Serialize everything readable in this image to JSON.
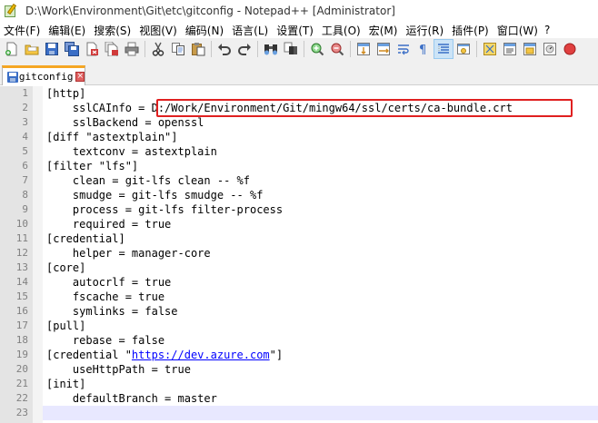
{
  "window": {
    "title": "D:\\Work\\Environment\\Git\\etc\\gitconfig - Notepad++ [Administrator]"
  },
  "menu": {
    "items": [
      "文件(F)",
      "编辑(E)",
      "搜索(S)",
      "视图(V)",
      "编码(N)",
      "语言(L)",
      "设置(T)",
      "工具(O)",
      "宏(M)",
      "运行(R)",
      "插件(P)",
      "窗口(W)",
      "?"
    ]
  },
  "toolbar": {
    "icons": [
      "new-file-icon",
      "open-file-icon",
      "save-icon",
      "save-all-icon",
      "close-icon",
      "close-all-icon",
      "print-icon",
      "cut-icon",
      "copy-icon",
      "paste-icon",
      "undo-icon",
      "redo-icon",
      "find-icon",
      "replace-icon",
      "zoom-in-icon",
      "zoom-out-icon",
      "sync-vertical-icon",
      "sync-horizontal-icon",
      "word-wrap-icon",
      "show-all-chars-icon",
      "indent-guide-icon",
      "user-lang-icon",
      "doc-map-icon",
      "function-list-icon",
      "folder-workspace-icon",
      "monitoring-icon",
      "record-macro-icon"
    ],
    "active_icon": "indent-guide-icon"
  },
  "tabs": [
    {
      "label": "gitconfig",
      "active": true,
      "close_symbol": "×"
    }
  ],
  "editor": {
    "lines": [
      {
        "num": "1",
        "text": "[http]"
      },
      {
        "num": "2",
        "text": "    sslCAInfo = D:/Work/Environment/Git/mingw64/ssl/certs/ca-bundle.crt"
      },
      {
        "num": "3",
        "text": "    sslBackend = openssl"
      },
      {
        "num": "4",
        "text": "[diff \"astextplain\"]"
      },
      {
        "num": "5",
        "text": "    textconv = astextplain"
      },
      {
        "num": "6",
        "text": "[filter \"lfs\"]"
      },
      {
        "num": "7",
        "text": "    clean = git-lfs clean -- %f"
      },
      {
        "num": "8",
        "text": "    smudge = git-lfs smudge -- %f"
      },
      {
        "num": "9",
        "text": "    process = git-lfs filter-process"
      },
      {
        "num": "10",
        "text": "    required = true"
      },
      {
        "num": "11",
        "text": "[credential]"
      },
      {
        "num": "12",
        "text": "    helper = manager-core"
      },
      {
        "num": "13",
        "text": "[core]"
      },
      {
        "num": "14",
        "text": "    autocrlf = true"
      },
      {
        "num": "15",
        "text": "    fscache = true"
      },
      {
        "num": "16",
        "text": "    symlinks = false"
      },
      {
        "num": "17",
        "text": "[pull]"
      },
      {
        "num": "18",
        "text": "    rebase = false"
      },
      {
        "num": "19",
        "text": "[credential \"",
        "url": "https://dev.azure.com",
        "after": "\"]"
      },
      {
        "num": "20",
        "text": "    useHttpPath = true"
      },
      {
        "num": "21",
        "text": "[init]"
      },
      {
        "num": "22",
        "text": "    defaultBranch = master"
      },
      {
        "num": "23",
        "text": ""
      }
    ],
    "current_line": "23",
    "highlighted_line": "2"
  },
  "colors": {
    "line_numbers": "#808080",
    "gutter": "#e4e4e4",
    "current_line": "#e8e8ff",
    "highlight_box": "#e02020",
    "url": "#0000ff",
    "tab_accent": "#f5a623"
  }
}
